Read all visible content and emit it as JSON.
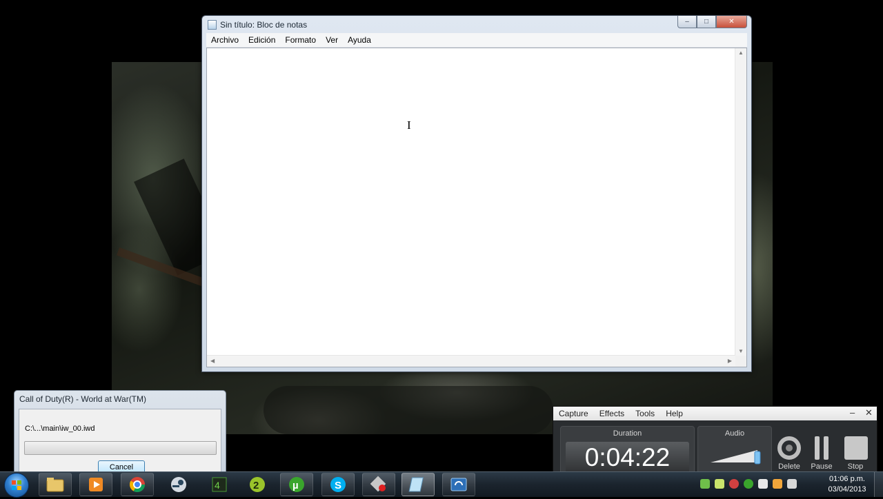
{
  "notepad": {
    "title": "Sin título: Bloc de notas",
    "menu": [
      "Archivo",
      "Edición",
      "Formato",
      "Ver",
      "Ayuda"
    ],
    "controls": {
      "minimize": "–",
      "maximize": "□",
      "close": "✕"
    },
    "text_cursor": "I"
  },
  "cod_dialog": {
    "title": "Call of Duty(R) - World at War(TM)",
    "path": "C:\\...\\main\\iw_00.iwd",
    "cancel_label": "Cancel"
  },
  "recorder": {
    "menu": [
      "Capture",
      "Effects",
      "Tools",
      "Help"
    ],
    "minimize": "–",
    "close": "✕",
    "duration_label": "Duration",
    "duration_value": "0:04:22",
    "audio_label": "Audio",
    "buttons": {
      "delete": "Delete",
      "pause": "Pause",
      "stop": "Stop"
    }
  },
  "taskbar": {
    "items": [
      "windows-explorer-icon",
      "media-player-icon",
      "chrome-icon",
      "steam-icon",
      "call-of-duty-icon",
      "modern-warfare-2-icon",
      "utorrent-icon",
      "skype-icon",
      "recorder-icon",
      "notepad-icon",
      "task-switcher-icon"
    ],
    "clock_time": "01:06 p.m.",
    "clock_date": "03/04/2013"
  },
  "colors": {
    "taskbar": "#1b242d",
    "window_chrome": "#dfe7f1",
    "close_button": "#c7503a",
    "recorder_panel": "#2a2d30"
  }
}
